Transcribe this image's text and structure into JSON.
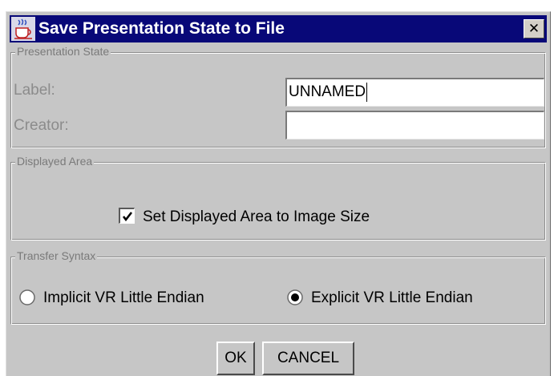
{
  "window": {
    "title": "Save Presentation State to File",
    "close_glyph": "✕",
    "app_icon": "java-coffee-cup-icon",
    "titlebar_color": "#080878"
  },
  "presentation_state": {
    "group_title": "Presentation State",
    "label_caption": "Label:",
    "label_value": "UNNAMED",
    "creator_caption": "Creator:",
    "creator_value": ""
  },
  "displayed_area": {
    "group_title": "Displayed Area",
    "checkbox_label": "Set Displayed Area to Image Size",
    "checked": true
  },
  "transfer_syntax": {
    "group_title": "Transfer Syntax",
    "options": [
      {
        "label": "Implicit VR Little Endian",
        "selected": false
      },
      {
        "label": "Explicit VR Little Endian",
        "selected": true
      }
    ]
  },
  "buttons": {
    "ok_label": "OK",
    "cancel_label": "CANCEL"
  }
}
